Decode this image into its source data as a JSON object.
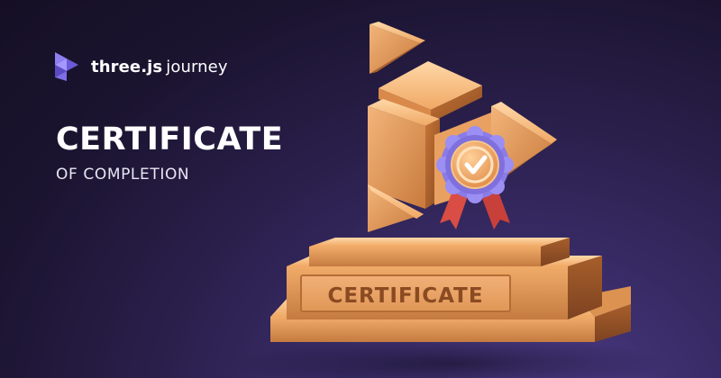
{
  "brand": {
    "name_bold": "three.js",
    "name_light": "journey",
    "logo_icon": "threejs-journey-logo-icon"
  },
  "heading": {
    "title": "CERTIFICATE",
    "subtitle": "OF COMPLETION"
  },
  "trophy": {
    "plaque_label": "CERTIFICATE",
    "badge_icon": "check-icon"
  },
  "colors": {
    "background": "#1b1430",
    "accent_purple": "#7b6cf0",
    "gold": "#e39a52",
    "ribbon_red": "#d94d45"
  }
}
